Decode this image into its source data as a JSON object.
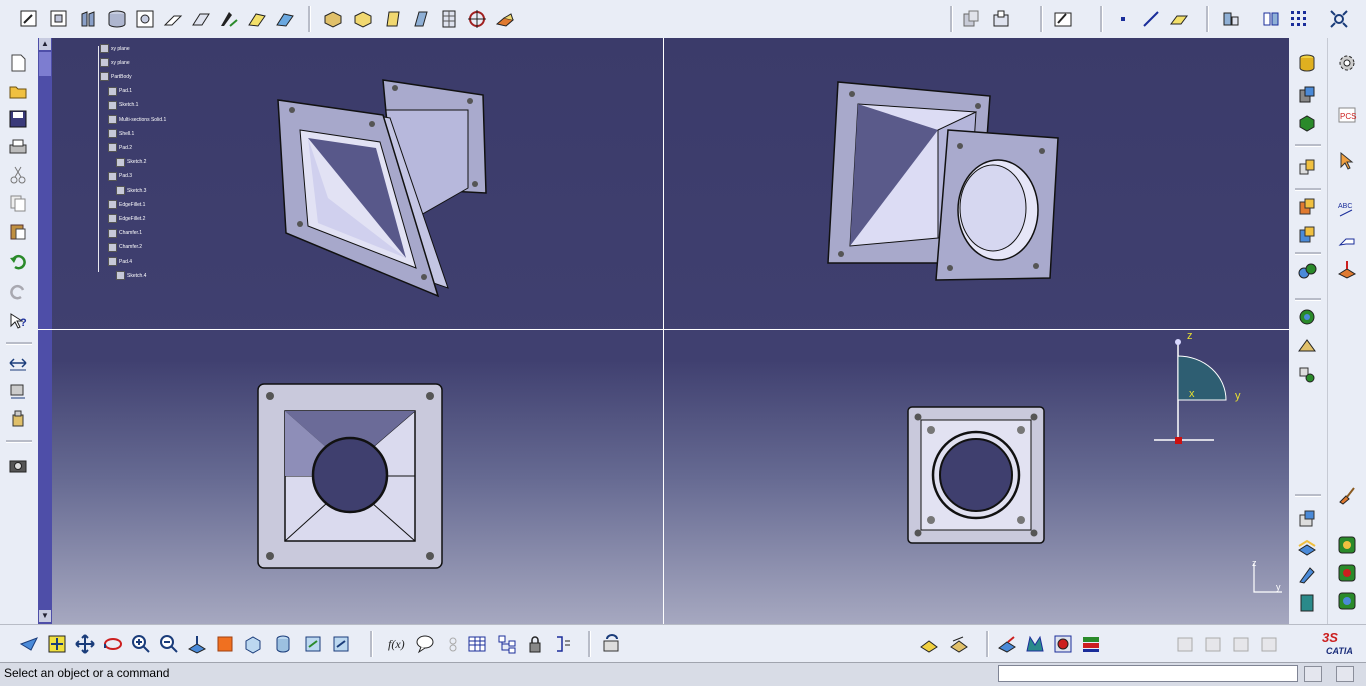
{
  "status": {
    "message": "Select an object or a command",
    "command_input": ""
  },
  "tree": {
    "nodes": [
      {
        "label": "xy plane"
      },
      {
        "label": "xy plane"
      },
      {
        "label": "PartBody"
      },
      {
        "label": "Pad.1"
      },
      {
        "label": "Sketch.1"
      },
      {
        "label": "Multi-sections Solid.1"
      },
      {
        "label": "Shell.1"
      },
      {
        "label": "Pad.2"
      },
      {
        "label": "Sketch.2"
      },
      {
        "label": "Pad.3"
      },
      {
        "label": "Sketch.3"
      },
      {
        "label": "EdgeFillet.1"
      },
      {
        "label": "EdgeFillet.2"
      },
      {
        "label": "Chamfer.1"
      },
      {
        "label": "Chamfer.2"
      },
      {
        "label": "Pad.4"
      },
      {
        "label": "Sketch.4"
      }
    ]
  },
  "compass": {
    "z": "z",
    "x": "x",
    "y": "y"
  },
  "axis_indicator": {
    "z": "z",
    "y": "y"
  },
  "brand": {
    "logo_text": "CATIA",
    "accent": "#cc1f1f"
  },
  "toolbars": {
    "top_left": [
      "sketch-icon",
      "pad-icon",
      "pocket-icon",
      "shaft-icon",
      "hole-icon",
      "rib-icon",
      "slot-icon",
      "stiffener-icon",
      "multi-section-icon",
      "removed-multi-section-icon"
    ],
    "top_mid": [
      "fillet-icon",
      "chamfer-icon",
      "draft-icon",
      "shell-icon",
      "thickness-icon",
      "thread-icon",
      "remove-face-icon"
    ],
    "right_col": [
      "material-icon",
      "apply-material-icon",
      "measure-icon",
      "publication-icon",
      "cursor-icon",
      "text-icon",
      "dimension-icon",
      "annotation-icon"
    ]
  }
}
